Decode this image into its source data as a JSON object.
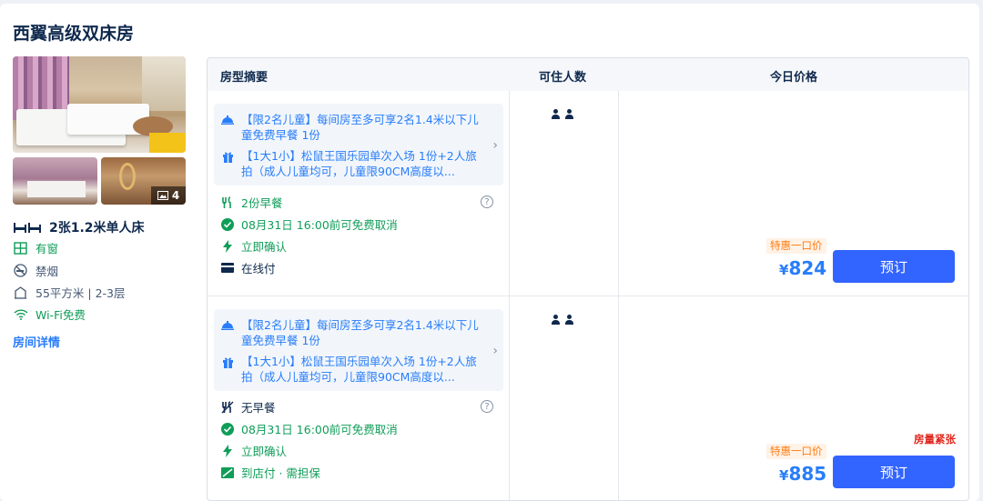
{
  "room": {
    "title": "西翼高级双床房",
    "photo_count": "4",
    "bed": "2张1.2米单人床",
    "features": [
      {
        "icon": "window-icon",
        "label": "有窗"
      },
      {
        "icon": "no-smoking-icon",
        "label": "禁烟"
      },
      {
        "icon": "area-icon",
        "label": "55平方米 | 2-3层"
      },
      {
        "icon": "wifi-icon",
        "label": "Wi-Fi免费"
      }
    ],
    "detail_link": "房间详情"
  },
  "table": {
    "headers": {
      "summary": "房型摘要",
      "occupancy": "可住人数",
      "price": "今日价格"
    },
    "rows": [
      {
        "pkg_line1": "【限2名儿童】每间房至多可享2名1.4米以下儿童免费早餐 1份",
        "pkg_line2": "【1大1小】松鼠王国乐园单次入场 1份+2人旅拍（成人儿童均可，儿童限90CM高度以...",
        "meal": "2份早餐",
        "cancel": "08月31日 16:00前可免费取消",
        "confirm": "立即确认",
        "payment": "在线付",
        "promo": "特惠一口价",
        "currency": "¥",
        "price": "824",
        "book": "预订",
        "scarce": ""
      },
      {
        "pkg_line1": "【限2名儿童】每间房至多可享2名1.4米以下儿童免费早餐 1份",
        "pkg_line2": "【1大1小】松鼠王国乐园单次入场 1份+2人旅拍（成人儿童均可，儿童限90CM高度以...",
        "meal": "无早餐",
        "cancel": "08月31日 16:00前可免费取消",
        "confirm": "立即确认",
        "payment": "到店付 · 需担保",
        "promo": "特惠一口价",
        "currency": "¥",
        "price": "885",
        "book": "预订",
        "scarce": "房量紧张"
      }
    ]
  },
  "colors": {
    "accent": "#287dfa",
    "button": "#3264ff",
    "green": "#0f9d58",
    "promo": "#ff7d13",
    "alert": "#e0251b"
  }
}
